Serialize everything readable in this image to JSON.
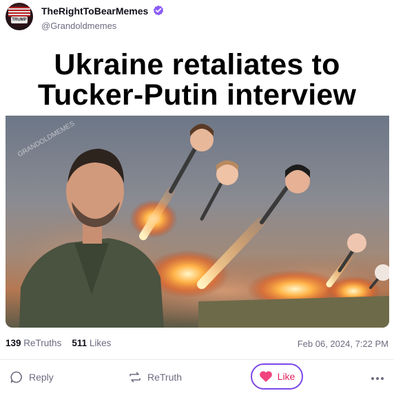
{
  "post": {
    "display_name": "TheRightToBearMemes",
    "handle": "@Grandoldmemes",
    "verified_icon": "verified-badge-icon",
    "meme_headline_line1": "Ukraine retaliates to",
    "meme_headline_line2": "Tucker-Putin interview",
    "watermark": "GRANDOLDMEMES",
    "avatar_tag": "TRUMP"
  },
  "stats": {
    "retruths_count": "139",
    "retruths_label": "ReTruths",
    "likes_count": "511",
    "likes_label": "Likes",
    "timestamp": "Feb 06, 2024, 7:22 PM"
  },
  "actions": {
    "reply_label": "Reply",
    "retruth_label": "ReTruth",
    "like_label": "Like",
    "more_icon": "more-horizontal-icon"
  },
  "colors": {
    "accent_purple": "#7b46e8",
    "verified_purple": "#8b5cf6",
    "like_pink": "#e0245e",
    "muted_text": "#6b6b80"
  }
}
